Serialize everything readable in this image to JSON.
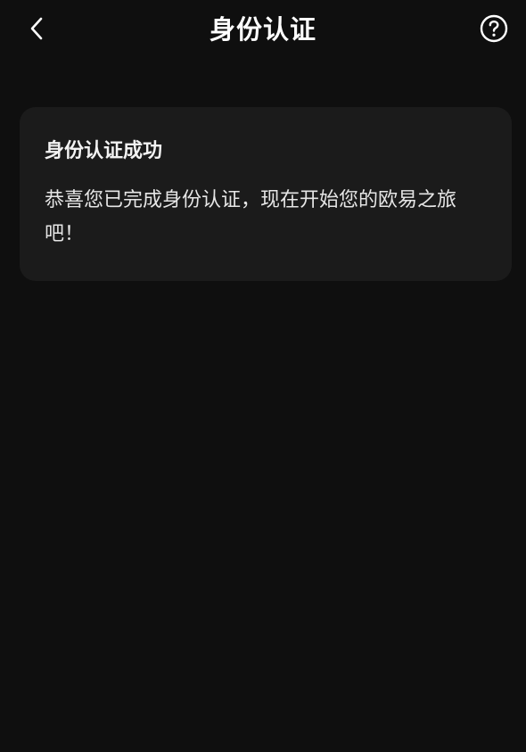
{
  "header": {
    "title": "身份认证",
    "back_icon": "chevron-left-icon",
    "help_icon": "question-circle-icon"
  },
  "card": {
    "title": "身份认证成功",
    "body": "恭喜您已完成身份认证，现在开始您的欧易之旅吧！"
  },
  "colors": {
    "background": "#0f0f0f",
    "card_background": "#1b1b1b",
    "text": "#ffffff"
  }
}
